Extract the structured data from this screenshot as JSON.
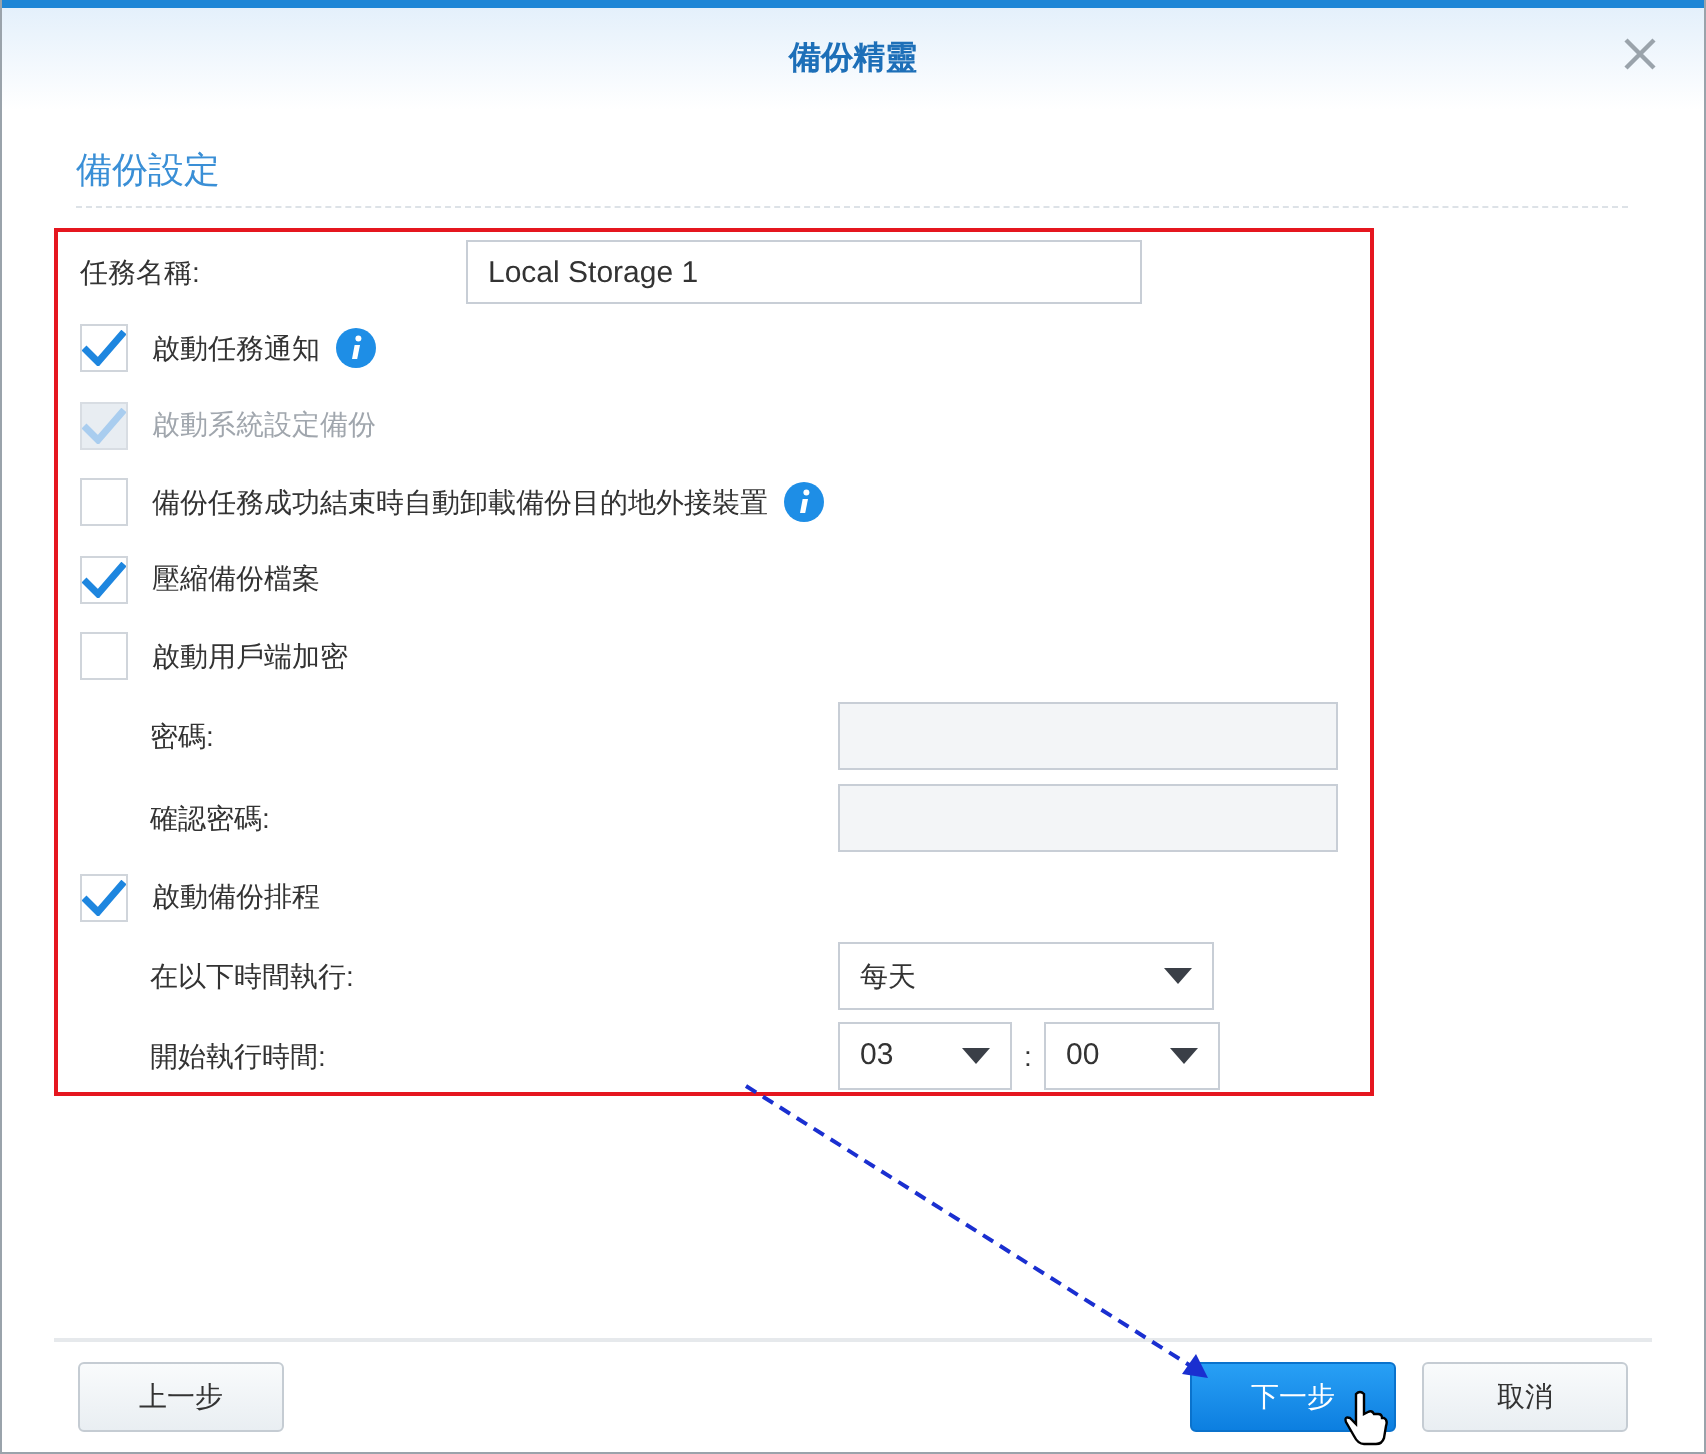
{
  "window": {
    "title": "備份精靈"
  },
  "section": {
    "title": "備份設定"
  },
  "rows": [
    {
      "kind": "text",
      "label": "任務名稱:",
      "value": "Local Storage 1"
    },
    {
      "kind": "checkbox",
      "label": "啟動任務通知",
      "checked": true,
      "disabled": false,
      "info": true
    },
    {
      "kind": "checkbox",
      "label": "啟動系統設定備份",
      "checked": true,
      "disabled": true,
      "info": false
    },
    {
      "kind": "checkbox",
      "label": "備份任務成功結束時自動卸載備份目的地外接裝置",
      "checked": false,
      "disabled": false,
      "info": true
    },
    {
      "kind": "checkbox",
      "label": "壓縮備份檔案",
      "checked": true,
      "disabled": false,
      "info": false
    },
    {
      "kind": "checkbox",
      "label": "啟動用戶端加密",
      "checked": false,
      "disabled": false,
      "info": false
    },
    {
      "kind": "password",
      "label": "密碼:"
    },
    {
      "kind": "password",
      "label": "確認密碼:"
    },
    {
      "kind": "checkbox",
      "label": "啟動備份排程",
      "checked": true,
      "disabled": false,
      "info": false
    },
    {
      "kind": "dropdown",
      "label": "在以下時間執行:",
      "value": "每天"
    },
    {
      "kind": "time",
      "label": "開始執行時間:",
      "hour": "03",
      "separator": ":",
      "minute": "00"
    }
  ],
  "buttons": [
    {
      "label": "上一步",
      "primary": false
    },
    {
      "label": "下一步",
      "primary": true
    },
    {
      "label": "取消",
      "primary": false
    }
  ]
}
